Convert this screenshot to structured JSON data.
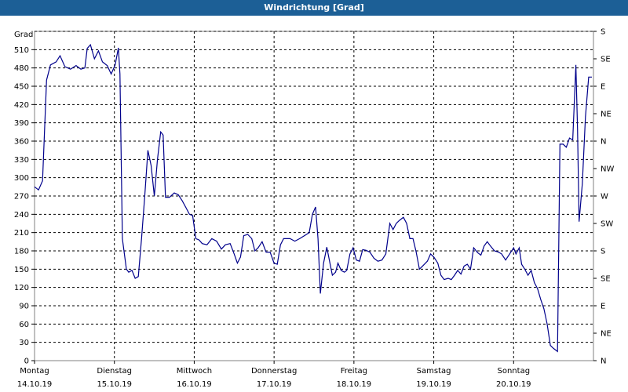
{
  "window": {
    "title": "Windrichtung [Grad]"
  },
  "chart_data": {
    "type": "line",
    "title": "Windrichtung [Grad]",
    "ylabel": "Grad",
    "ylim": [
      0,
      540
    ],
    "yticks": [
      0,
      30,
      60,
      90,
      120,
      150,
      180,
      210,
      240,
      270,
      300,
      330,
      360,
      390,
      420,
      450,
      480,
      510
    ],
    "right_ticks": [
      {
        "value": 0,
        "label": "N"
      },
      {
        "value": 45,
        "label": "NE"
      },
      {
        "value": 90,
        "label": "E"
      },
      {
        "value": 135,
        "label": "SE"
      },
      {
        "value": 180,
        "label": "S"
      },
      {
        "value": 225,
        "label": "SW"
      },
      {
        "value": 270,
        "label": "W"
      },
      {
        "value": 315,
        "label": "NW"
      },
      {
        "value": 360,
        "label": "N"
      },
      {
        "value": 405,
        "label": "NE"
      },
      {
        "value": 450,
        "label": "E"
      },
      {
        "value": 495,
        "label": "SE"
      },
      {
        "value": 540,
        "label": "S"
      }
    ],
    "x_unit": "days",
    "xlim": [
      0,
      7
    ],
    "x_ticks": [
      {
        "day": "Montag",
        "date": "14.10.19"
      },
      {
        "day": "Dienstag",
        "date": "15.10.19"
      },
      {
        "day": "Mittwoch",
        "date": "16.10.19"
      },
      {
        "day": "Donnerstag",
        "date": "17.10.19"
      },
      {
        "day": "Freitag",
        "date": "18.10.19"
      },
      {
        "day": "Samstag",
        "date": "19.10.19"
      },
      {
        "day": "Sonntag",
        "date": "20.10.19"
      }
    ],
    "grid": true,
    "line_color": "#00008b",
    "series": [
      {
        "values": [
          [
            0.0,
            285
          ],
          [
            0.05,
            280
          ],
          [
            0.1,
            295
          ],
          [
            0.15,
            460
          ],
          [
            0.2,
            485
          ],
          [
            0.27,
            490
          ],
          [
            0.32,
            500
          ],
          [
            0.38,
            482
          ],
          [
            0.45,
            478
          ],
          [
            0.52,
            484
          ],
          [
            0.58,
            478
          ],
          [
            0.63,
            480
          ],
          [
            0.66,
            512
          ],
          [
            0.7,
            518
          ],
          [
            0.75,
            495
          ],
          [
            0.8,
            508
          ],
          [
            0.85,
            490
          ],
          [
            0.91,
            484
          ],
          [
            0.96,
            470
          ],
          [
            1.01,
            485
          ],
          [
            1.05,
            513
          ],
          [
            1.07,
            470
          ],
          [
            1.1,
            200
          ],
          [
            1.15,
            150
          ],
          [
            1.18,
            145
          ],
          [
            1.22,
            148
          ],
          [
            1.26,
            135
          ],
          [
            1.3,
            138
          ],
          [
            1.34,
            200
          ],
          [
            1.38,
            270
          ],
          [
            1.42,
            345
          ],
          [
            1.46,
            320
          ],
          [
            1.5,
            270
          ],
          [
            1.54,
            330
          ],
          [
            1.58,
            375
          ],
          [
            1.61,
            370
          ],
          [
            1.64,
            268
          ],
          [
            1.69,
            268
          ],
          [
            1.75,
            275
          ],
          [
            1.8,
            272
          ],
          [
            1.85,
            262
          ],
          [
            1.9,
            250
          ],
          [
            1.94,
            240
          ],
          [
            1.98,
            238
          ],
          [
            2.02,
            200
          ],
          [
            2.06,
            198
          ],
          [
            2.1,
            192
          ],
          [
            2.16,
            190
          ],
          [
            2.22,
            200
          ],
          [
            2.28,
            196
          ],
          [
            2.34,
            183
          ],
          [
            2.39,
            190
          ],
          [
            2.45,
            192
          ],
          [
            2.5,
            175
          ],
          [
            2.54,
            160
          ],
          [
            2.58,
            170
          ],
          [
            2.62,
            205
          ],
          [
            2.67,
            207
          ],
          [
            2.72,
            200
          ],
          [
            2.76,
            180
          ],
          [
            2.8,
            185
          ],
          [
            2.85,
            195
          ],
          [
            2.9,
            178
          ],
          [
            2.95,
            178
          ],
          [
            3.0,
            160
          ],
          [
            3.04,
            158
          ],
          [
            3.08,
            190
          ],
          [
            3.12,
            200
          ],
          [
            3.2,
            200
          ],
          [
            3.26,
            196
          ],
          [
            3.32,
            200
          ],
          [
            3.38,
            205
          ],
          [
            3.44,
            210
          ],
          [
            3.48,
            240
          ],
          [
            3.52,
            252
          ],
          [
            3.55,
            200
          ],
          [
            3.58,
            110
          ],
          [
            3.62,
            160
          ],
          [
            3.66,
            186
          ],
          [
            3.7,
            160
          ],
          [
            3.73,
            140
          ],
          [
            3.77,
            145
          ],
          [
            3.8,
            160
          ],
          [
            3.84,
            148
          ],
          [
            3.88,
            145
          ],
          [
            3.91,
            148
          ],
          [
            3.95,
            175
          ],
          [
            3.99,
            185
          ],
          [
            4.03,
            165
          ],
          [
            4.07,
            163
          ],
          [
            4.11,
            182
          ],
          [
            4.15,
            181
          ],
          [
            4.2,
            178
          ],
          [
            4.25,
            168
          ],
          [
            4.3,
            163
          ],
          [
            4.35,
            165
          ],
          [
            4.4,
            175
          ],
          [
            4.45,
            225
          ],
          [
            4.49,
            215
          ],
          [
            4.53,
            225
          ],
          [
            4.57,
            230
          ],
          [
            4.62,
            235
          ],
          [
            4.66,
            225
          ],
          [
            4.7,
            200
          ],
          [
            4.74,
            200
          ],
          [
            4.78,
            178
          ],
          [
            4.82,
            150
          ],
          [
            4.86,
            155
          ],
          [
            4.92,
            163
          ],
          [
            4.96,
            175
          ],
          [
            5.0,
            170
          ],
          [
            5.05,
            160
          ],
          [
            5.09,
            140
          ],
          [
            5.13,
            133
          ],
          [
            5.18,
            135
          ],
          [
            5.22,
            133
          ],
          [
            5.26,
            140
          ],
          [
            5.3,
            148
          ],
          [
            5.34,
            142
          ],
          [
            5.38,
            155
          ],
          [
            5.42,
            158
          ],
          [
            5.46,
            150
          ],
          [
            5.5,
            185
          ],
          [
            5.55,
            177
          ],
          [
            5.59,
            173
          ],
          [
            5.63,
            188
          ],
          [
            5.67,
            195
          ],
          [
            5.71,
            188
          ],
          [
            5.76,
            180
          ],
          [
            5.81,
            178
          ],
          [
            5.85,
            175
          ],
          [
            5.9,
            165
          ],
          [
            5.95,
            175
          ],
          [
            6.0,
            185
          ],
          [
            6.03,
            175
          ],
          [
            6.07,
            185
          ],
          [
            6.1,
            158
          ],
          [
            6.14,
            150
          ],
          [
            6.18,
            140
          ],
          [
            6.22,
            148
          ],
          [
            6.26,
            128
          ],
          [
            6.3,
            118
          ],
          [
            6.34,
            100
          ],
          [
            6.38,
            85
          ],
          [
            6.42,
            60
          ],
          [
            6.46,
            25
          ],
          [
            6.5,
            20
          ],
          [
            6.55,
            15
          ],
          [
            6.58,
            355
          ],
          [
            6.62,
            355
          ],
          [
            6.66,
            350
          ],
          [
            6.7,
            365
          ],
          [
            6.74,
            362
          ],
          [
            6.78,
            485
          ],
          [
            6.8,
            380
          ],
          [
            6.82,
            228
          ],
          [
            6.86,
            290
          ],
          [
            6.9,
            400
          ],
          [
            6.94,
            465
          ],
          [
            6.98,
            465
          ]
        ]
      }
    ]
  }
}
